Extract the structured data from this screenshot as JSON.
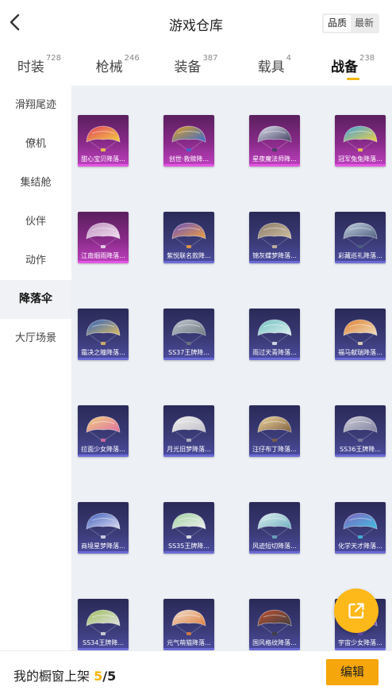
{
  "header": {
    "title": "游戏仓库",
    "sort_options": [
      "品质",
      "最新"
    ],
    "sort_active": "品质"
  },
  "tabs": [
    {
      "label": "时装",
      "count": "728"
    },
    {
      "label": "枪械",
      "count": "246"
    },
    {
      "label": "装备",
      "count": "387"
    },
    {
      "label": "载具",
      "count": "4"
    },
    {
      "label": "战备",
      "count": "238",
      "active": true
    }
  ],
  "sidebar": {
    "items": [
      "滑翔尾迹",
      "僚机",
      "集结舱",
      "伙伴",
      "动作",
      "降落伞",
      "大厅场景"
    ],
    "active_index": 5
  },
  "items": [
    {
      "name": "甜心宝贝降落...",
      "rarity": "legendary",
      "colors": [
        "#e04060",
        "#f5d040"
      ]
    },
    {
      "name": "创世·救赎降...",
      "rarity": "legendary",
      "colors": [
        "#e0a020",
        "#3a6ad0"
      ]
    },
    {
      "name": "星夜魔法师降...",
      "rarity": "legendary",
      "colors": [
        "#e0e0f0",
        "#404060"
      ]
    },
    {
      "name": "冠军兔兔降落...",
      "rarity": "legendary",
      "colors": [
        "#40a0e0",
        "#f0d040"
      ]
    },
    {
      "name": "江南烟雨降落...",
      "rarity": "legendary",
      "colors": [
        "#c090c0",
        "#f0e0f0"
      ]
    },
    {
      "name": "紫悦联名款降...",
      "rarity": "epic",
      "colors": [
        "#6a50c0",
        "#f0a040"
      ]
    },
    {
      "name": "锦灰蝶梦降落...",
      "rarity": "epic",
      "colors": [
        "#8a7a6a",
        "#d0c0a0"
      ]
    },
    {
      "name": "彩藏巡礼降落...",
      "rarity": "epic",
      "colors": [
        "#c0d0e0",
        "#506080"
      ]
    },
    {
      "name": "霜决之瞳降落...",
      "rarity": "epic",
      "colors": [
        "#3060c0",
        "#e0c060"
      ]
    },
    {
      "name": "SS37王牌降...",
      "rarity": "epic",
      "colors": [
        "#c0c8d0",
        "#707880"
      ]
    },
    {
      "name": "雨过天青降落...",
      "rarity": "epic",
      "colors": [
        "#70c0c0",
        "#e0f0f0"
      ]
    },
    {
      "name": "福马献瑞降落...",
      "rarity": "epic",
      "colors": [
        "#e08030",
        "#f0e0c0"
      ]
    },
    {
      "name": "拉面少女降落...",
      "rarity": "epic",
      "colors": [
        "#f0d080",
        "#e070a0"
      ]
    },
    {
      "name": "月光旧梦降落...",
      "rarity": "epic",
      "colors": [
        "#f0f0f0",
        "#c0c0c8"
      ]
    },
    {
      "name": "汪仔布丁降落...",
      "rarity": "epic",
      "colors": [
        "#f0d8a0",
        "#806040"
      ]
    },
    {
      "name": "SS36王牌降...",
      "rarity": "epic",
      "colors": [
        "#d0d0d8",
        "#8080a0"
      ]
    },
    {
      "name": "商境星梦降落...",
      "rarity": "epic",
      "colors": [
        "#4060c0",
        "#e0e0f0"
      ]
    },
    {
      "name": "SS35王牌降...",
      "rarity": "epic",
      "colors": [
        "#a0d0a0",
        "#f0f0f0"
      ]
    },
    {
      "name": "风迹短切降落...",
      "rarity": "epic",
      "colors": [
        "#e0f0f0",
        "#70b0c0"
      ]
    },
    {
      "name": "化学天才降落...",
      "rarity": "epic",
      "colors": [
        "#8060c0",
        "#40c0e0"
      ]
    },
    {
      "name": "SS34王牌降...",
      "rarity": "epic",
      "colors": [
        "#a0c060",
        "#e0e0e0"
      ]
    },
    {
      "name": "元气萌猫降落...",
      "rarity": "epic",
      "colors": [
        "#f0e0d0",
        "#e08040"
      ]
    },
    {
      "name": "国风格纹降落...",
      "rarity": "epic",
      "colors": [
        "#c05030",
        "#404040"
      ]
    },
    {
      "name": "宇宙少女降落...",
      "rarity": "epic",
      "colors": [
        "#f0d0e0",
        "#7050c0"
      ]
    }
  ],
  "footer": {
    "shelf_label": "我的橱窗上架",
    "shelf_count": "5",
    "shelf_total": "/5",
    "edit_label": "编辑"
  },
  "colors": {
    "accent": "#f5b500",
    "button": "#f5a60a",
    "legendary": "#c040c0",
    "epic": "#4c4ca0"
  }
}
